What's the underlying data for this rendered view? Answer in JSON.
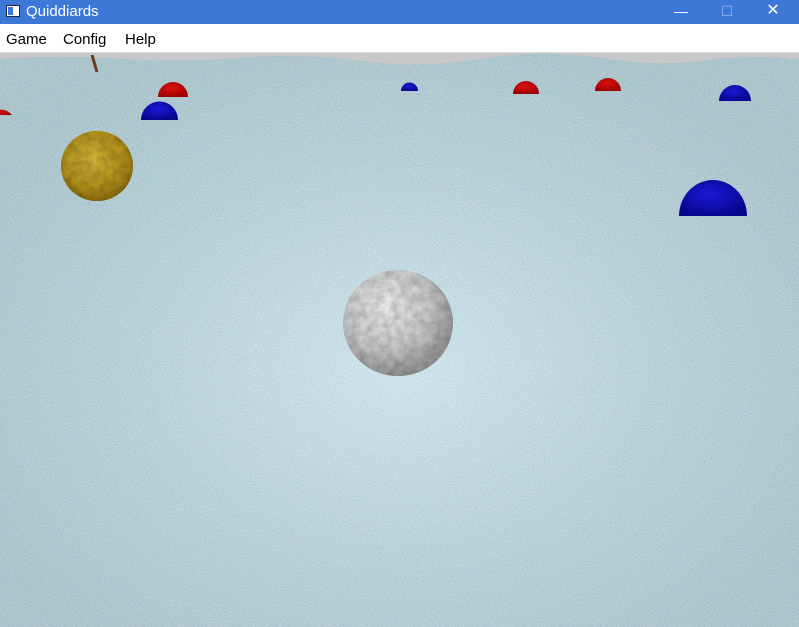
{
  "window": {
    "title": "Quiddiards",
    "buttons": {
      "minimize": "—",
      "maximize": "☐",
      "close": "✕"
    }
  },
  "menu": {
    "items": [
      {
        "id": "game",
        "label": "Game"
      },
      {
        "id": "config",
        "label": "Config"
      },
      {
        "id": "help",
        "label": "Help"
      }
    ]
  },
  "scene": {
    "icons": {
      "cue_ball": "white-textured-sphere",
      "golden_ball": "yellow-textured-sphere",
      "red_balls": "red-half-sphere",
      "blue_balls": "blue-half-sphere",
      "stick": "brown-stick"
    },
    "colors": {
      "water": "#6fa3b5",
      "cue_ball": "#e6e6e6",
      "golden_ball": "#c9a826",
      "red_ball": "#cc0000",
      "blue_ball": "#0d0dbf",
      "stick": "#6b3a1a",
      "sky": "#c8c8c8"
    }
  }
}
